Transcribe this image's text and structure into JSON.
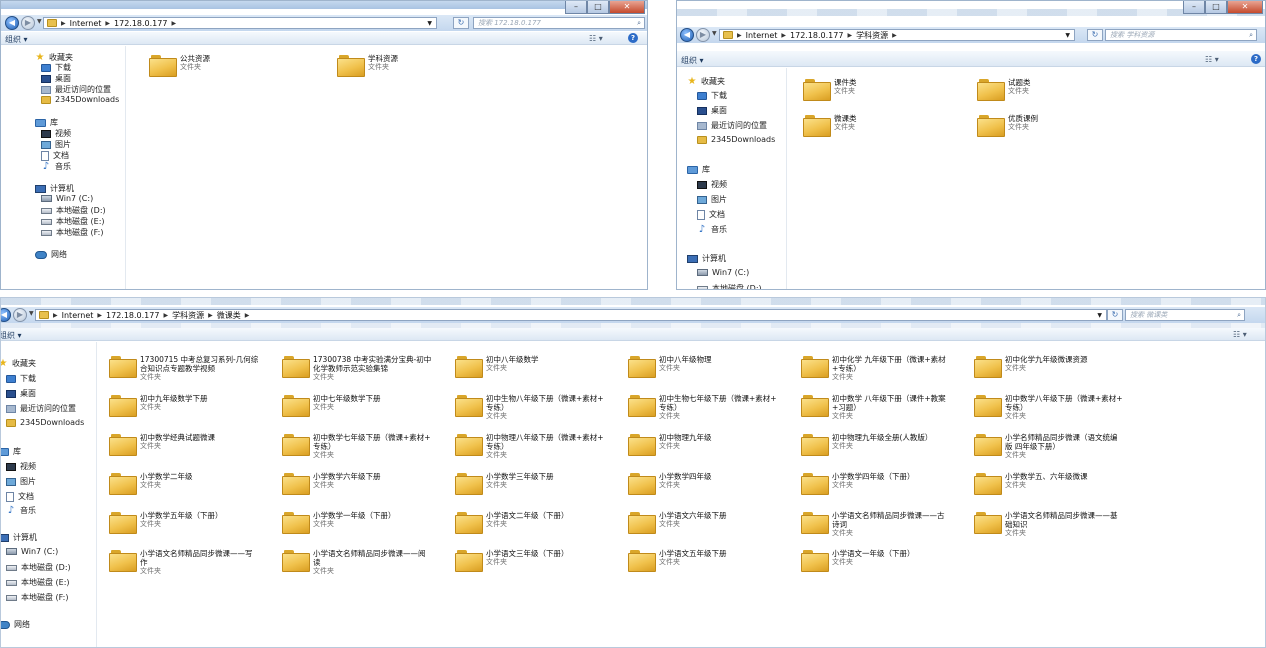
{
  "common": {
    "organize": "组织 ▾",
    "folder_type": "文件夹",
    "minimize": "–",
    "maximize": "□",
    "close": "✕"
  },
  "nav": {
    "favorites": "收藏夹",
    "downloads": "下载",
    "desktop": "桌面",
    "recent": "最近访问的位置",
    "downloads2345": "2345Downloads",
    "libraries": "库",
    "videos": "视频",
    "pictures": "图片",
    "documents": "文档",
    "music": "音乐",
    "computer": "计算机",
    "drive_c": "Win7 (C:)",
    "drive_d": "本地磁盘 (D:)",
    "drive_e": "本地磁盘 (E:)",
    "drive_f": "本地磁盘 (F:)",
    "network": "网络"
  },
  "win1": {
    "crumbs": [
      "Internet",
      "172.18.0.177"
    ],
    "search_placeholder": "搜索 172.18.0.177",
    "folders": [
      {
        "name": "公共资源"
      },
      {
        "name": "学科资源"
      }
    ]
  },
  "win2": {
    "crumbs": [
      "Internet",
      "172.18.0.177",
      "学科资源"
    ],
    "search_placeholder": "搜索 学科资源",
    "folders": [
      {
        "name": "课件类"
      },
      {
        "name": "试题类"
      },
      {
        "name": "微课类"
      },
      {
        "name": "优质课例"
      }
    ]
  },
  "win3": {
    "crumbs": [
      "Internet",
      "172.18.0.177",
      "学科资源",
      "微课类"
    ],
    "search_placeholder": "搜索 微课类",
    "folders": [
      {
        "l1": "17300715 中考总复习系列-几何综",
        "l2": "合知识点专题教学视频"
      },
      {
        "l1": "17300738 中考实验满分宝典-初中",
        "l2": "化学教师示范实验集锦"
      },
      {
        "l1": "初中八年级数学",
        "l2": ""
      },
      {
        "l1": "初中八年级物理",
        "l2": ""
      },
      {
        "l1": "初中化学 九年级下册（微课+素材",
        "l2": "+专练）"
      },
      {
        "l1": "初中化学九年级微课资源",
        "l2": ""
      },
      {
        "l1": "初中九年级数学下册",
        "l2": ""
      },
      {
        "l1": "初中七年级数学下册",
        "l2": ""
      },
      {
        "l1": "初中生物八年级下册（微课+素材+",
        "l2": "专练）"
      },
      {
        "l1": "初中生物七年级下册（微课+素材+",
        "l2": "专练）"
      },
      {
        "l1": "初中数学 八年级下册（课件+教案",
        "l2": "+习题）"
      },
      {
        "l1": "初中数学八年级下册（微课+素材+",
        "l2": "专练）"
      },
      {
        "l1": "初中数学经典试题微课",
        "l2": ""
      },
      {
        "l1": "初中数学七年级下册（微课+素材+",
        "l2": "专练）"
      },
      {
        "l1": "初中物理八年级下册（微课+素材+",
        "l2": "专练）"
      },
      {
        "l1": "初中物理九年级",
        "l2": ""
      },
      {
        "l1": "初中物理九年级全册(人教版）",
        "l2": ""
      },
      {
        "l1": "小学名师精品同步微课（语文统编",
        "l2": "版 四年级下册）"
      },
      {
        "l1": "小学数学二年级",
        "l2": ""
      },
      {
        "l1": "小学数学六年级下册",
        "l2": ""
      },
      {
        "l1": "小学数学三年级下册",
        "l2": ""
      },
      {
        "l1": "小学数学四年级",
        "l2": ""
      },
      {
        "l1": "小学数学四年级（下册）",
        "l2": ""
      },
      {
        "l1": "小学数学五、六年级微课",
        "l2": ""
      },
      {
        "l1": "小学数学五年级（下册）",
        "l2": ""
      },
      {
        "l1": "小学数学一年级（下册）",
        "l2": ""
      },
      {
        "l1": "小学语文二年级（下册）",
        "l2": ""
      },
      {
        "l1": "小学语文六年级下册",
        "l2": ""
      },
      {
        "l1": "小学语文名师精品同步微课——古",
        "l2": "诗词"
      },
      {
        "l1": "小学语文名师精品同步微课——基",
        "l2": "础知识"
      },
      {
        "l1": "小学语文名师精品同步微课——写",
        "l2": "作"
      },
      {
        "l1": "小学语文名师精品同步微课——阅",
        "l2": "读"
      },
      {
        "l1": "小学语文三年级（下册）",
        "l2": ""
      },
      {
        "l1": "小学语文五年级下册",
        "l2": ""
      },
      {
        "l1": "小学语文一年级（下册）",
        "l2": ""
      }
    ]
  }
}
